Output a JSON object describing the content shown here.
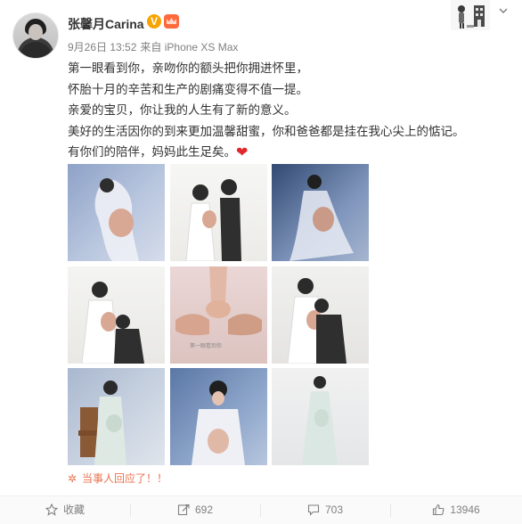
{
  "post": {
    "author": {
      "name": "张馨月Carina",
      "verified_mark": "V",
      "avatar_icon": "avatar-portrait"
    },
    "meta": {
      "date": "9月26日 13:52",
      "source": "来自 iPhone XS Max"
    },
    "text_lines": [
      "第一眼看到你，亲吻你的额头把你拥进怀里，",
      "怀胎十月的辛苦和生产的剧痛变得不值一提。",
      "亲爱的宝贝，你让我的人生有了新的意义。",
      "美好的生活因你的到来更加温馨甜蜜，你和爸爸都是挂在我心尖上的惦记。",
      "有你们的陪伴，妈妈此生足矣。"
    ],
    "emoji": "❤",
    "photo_caption": "第一眼看到你",
    "reply_notice": "当事人回应了！！"
  },
  "actions": [
    {
      "icon": "star-icon",
      "label": "收藏"
    },
    {
      "icon": "repost-icon",
      "label": "692"
    },
    {
      "icon": "comment-icon",
      "label": "703"
    },
    {
      "icon": "like-icon",
      "label": "13946"
    }
  ],
  "colors": {
    "accent": "#eb7350",
    "text": "#333333",
    "muted": "#808080",
    "vip": "#f7a300",
    "heart": "#e0282c"
  }
}
